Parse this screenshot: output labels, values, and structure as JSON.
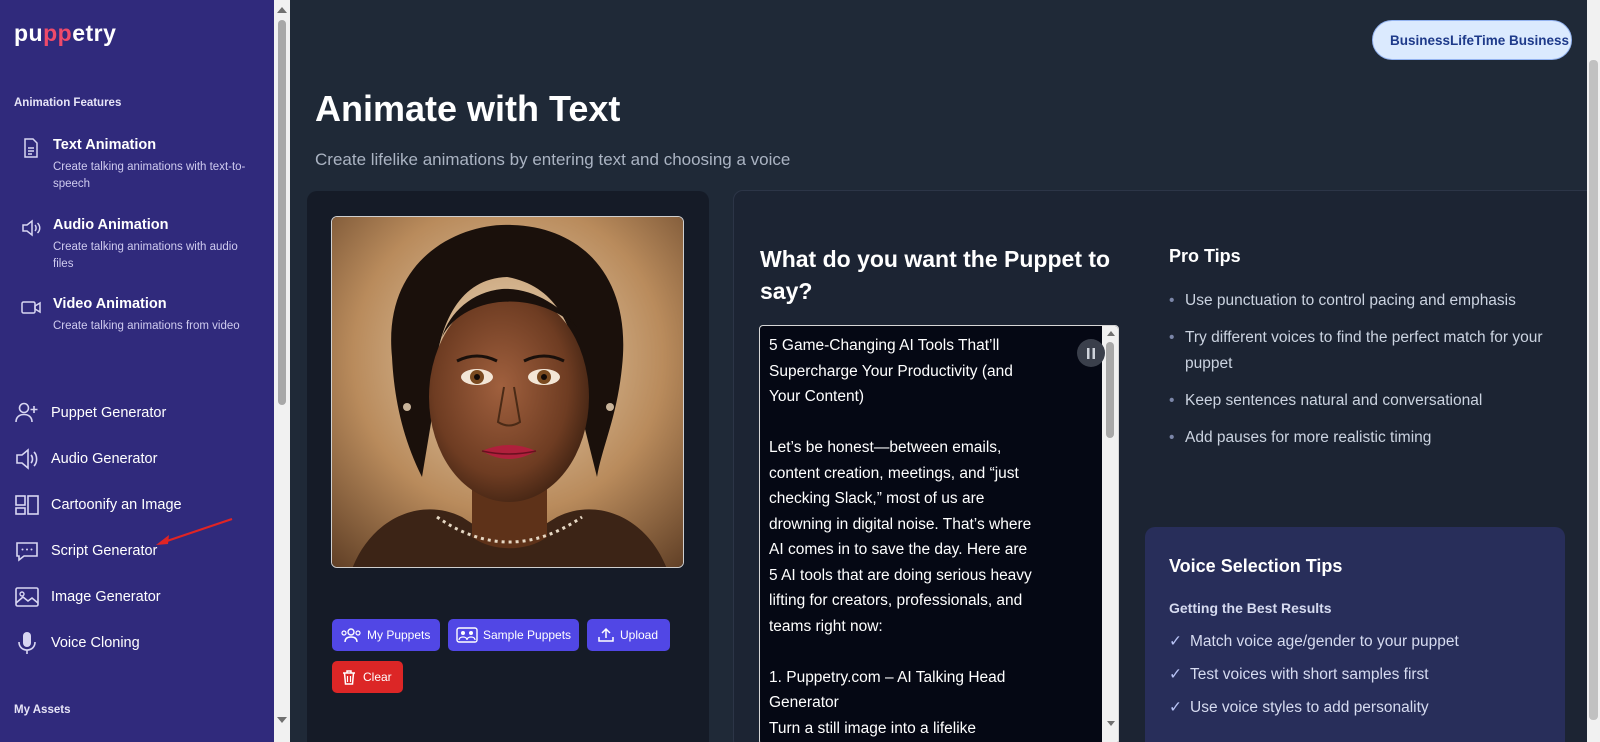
{
  "brand": {
    "logo_prefix": "pu",
    "logo_highlight": "pp",
    "logo_suffix": "etry"
  },
  "sidebar": {
    "section_animation": "Animation Features",
    "features": [
      {
        "title": "Text Animation",
        "desc": "Create talking animations with text-to-speech",
        "icon": "document-icon"
      },
      {
        "title": "Audio Animation",
        "desc": "Create talking animations with audio files",
        "icon": "speaker-icon"
      },
      {
        "title": "Video Animation",
        "desc": "Create talking animations from video",
        "icon": "video-camera-icon"
      }
    ],
    "tools": [
      {
        "label": "Puppet Generator",
        "icon": "user-plus-icon"
      },
      {
        "label": "Audio Generator",
        "icon": "speaker-icon"
      },
      {
        "label": "Cartoonify an Image",
        "icon": "layout-icon"
      },
      {
        "label": "Script Generator",
        "icon": "chat-bubble-icon"
      },
      {
        "label": "Image Generator",
        "icon": "image-icon"
      },
      {
        "label": "Voice Cloning",
        "icon": "microphone-icon"
      }
    ],
    "section_assets": "My Assets"
  },
  "header": {
    "plan_badge": "BusinessLifeTime Business"
  },
  "page": {
    "title": "Animate with Text",
    "subtitle": "Create lifelike animations by entering text and choosing a voice"
  },
  "puppet_panel": {
    "buttons": {
      "my_puppets": "My Puppets",
      "sample_puppets": "Sample Puppets",
      "upload": "Upload",
      "clear": "Clear"
    }
  },
  "script_panel": {
    "heading": "What do you want the Puppet to say?",
    "text": "5 Game-Changing AI Tools That’ll Supercharge Your Productivity (and Your Content)\n\nLet’s be honest—between emails, content creation, meetings, and “just checking Slack,” most of us are drowning in digital noise. That’s where AI comes in to save the day. Here are 5 AI tools that are doing serious heavy lifting for creators, professionals, and teams right now:\n\n1. Puppetry.com – AI Talking Head Generator\nTurn a still image into a lifelike"
  },
  "pro_tips": {
    "title": "Pro Tips",
    "items": [
      "Use punctuation to control pacing and emphasis",
      "Try different voices to find the perfect match for your puppet",
      "Keep sentences natural and conversational",
      "Add pauses for more realistic timing"
    ]
  },
  "voice_tips": {
    "title": "Voice Selection Tips",
    "subtitle": "Getting the Best Results",
    "check": "✓",
    "items": [
      "Match voice age/gender to your puppet",
      "Test voices with short samples first",
      "Use voice styles to add personality"
    ]
  },
  "colors": {
    "sidebar": "#302a7c",
    "accent": "#5147e5",
    "danger": "#dc2626",
    "bg": "#1f2937",
    "annotation": "#e02424"
  }
}
